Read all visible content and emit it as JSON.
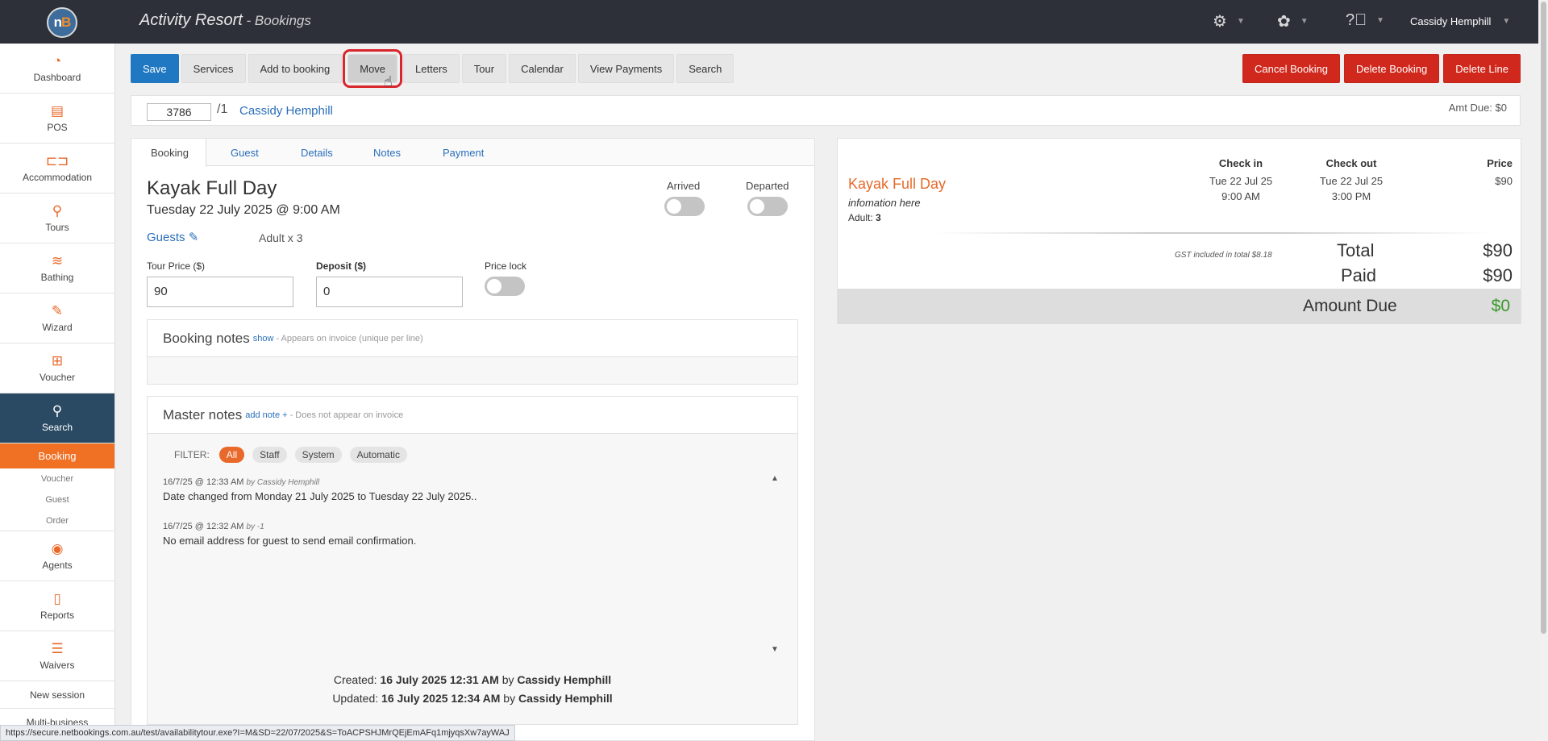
{
  "header": {
    "app_title": "Activity Resort",
    "app_subtitle": " - Bookings",
    "logo_text": "nB",
    "user_name": "Cassidy Hemphill"
  },
  "sidebar": {
    "items": [
      {
        "label": "Dashboard",
        "icon": "⌚"
      },
      {
        "label": "POS",
        "icon": "▤"
      },
      {
        "label": "Accommodation",
        "icon": "🛏"
      },
      {
        "label": "Tours",
        "icon": "⚲"
      },
      {
        "label": "Bathing",
        "icon": "≋"
      },
      {
        "label": "Wizard",
        "icon": "✎"
      },
      {
        "label": "Voucher",
        "icon": "🎁"
      },
      {
        "label": "Search",
        "icon": "🔍"
      }
    ],
    "sub_active": "Booking",
    "sub_items": [
      "Voucher",
      "Guest",
      "Order"
    ],
    "items2": [
      {
        "label": "Agents",
        "icon": "👥"
      },
      {
        "label": "Reports",
        "icon": "📄"
      },
      {
        "label": "Waivers",
        "icon": "☰"
      }
    ],
    "plain_items": [
      "New session",
      "Multi-business"
    ]
  },
  "toolbar": {
    "save": "Save",
    "services": "Services",
    "add_to_booking": "Add to booking",
    "move": "Move",
    "letters": "Letters",
    "tour": "Tour",
    "calendar": "Calendar",
    "view_payments": "View Payments",
    "search": "Search",
    "cancel_booking": "Cancel Booking",
    "delete_booking": "Delete Booking",
    "delete_line": "Delete Line"
  },
  "booking_bar": {
    "number": "3786",
    "suffix": "/1",
    "guest": "Cassidy Hemphill",
    "amt_due": "Amt Due: $0"
  },
  "tabs": [
    "Booking",
    "Guest",
    "Details",
    "Notes",
    "Payment"
  ],
  "booking": {
    "tour_name": "Kayak Full Day",
    "tour_date": "Tuesday 22 July 2025 @ 9:00 AM",
    "guests_label": "Guests",
    "guests_value": "Adult x 3",
    "arrived_label": "Arrived",
    "departed_label": "Departed",
    "tour_price_label": "Tour Price ($)",
    "tour_price": "90",
    "deposit_label": "Deposit ($)",
    "deposit": "0",
    "price_lock_label": "Price lock"
  },
  "booking_notes": {
    "title": "Booking notes",
    "link": "show",
    "hint": "- Appears on invoice (unique per line)"
  },
  "master_notes": {
    "title": "Master notes",
    "link": "add note +",
    "hint": "- Does not appear on invoice",
    "filter_label": "FILTER:",
    "filters": [
      "All",
      "Staff",
      "System",
      "Automatic"
    ],
    "entries": [
      {
        "meta": "16/7/25 @ 12:33 AM",
        "by": "by Cassidy Hemphill",
        "text": "Date changed from Monday 21 July 2025 to Tuesday 22 July 2025.."
      },
      {
        "meta": "16/7/25 @ 12:32 AM",
        "by": "by -1",
        "text": "No email address for guest to send email confirmation."
      }
    ],
    "created_label": "Created:",
    "created_date": "16 July 2025 12:31 AM",
    "created_by_word": "by",
    "created_by": "Cassidy Hemphill",
    "updated_label": "Updated:",
    "updated_date": "16 July 2025 12:34 AM",
    "updated_by_word": "by",
    "updated_by": "Cassidy Hemphill"
  },
  "summary": {
    "check_in_label": "Check in",
    "check_out_label": "Check out",
    "price_label": "Price",
    "item_name": "Kayak Full Day",
    "item_info": "infomation here",
    "adult_label": "Adult:",
    "adult_count": "3",
    "check_in_date": "Tue 22 Jul 25",
    "check_in_time": "9:00 AM",
    "check_out_date": "Tue 22 Jul 25",
    "check_out_time": "3:00 PM",
    "price": "$90",
    "gst": "GST included in total $8.18",
    "total_label": "Total",
    "total": "$90",
    "paid_label": "Paid",
    "paid": "$90",
    "due_label": "Amount Due",
    "due": "$0"
  },
  "status_url": "https://secure.netbookings.com.au/test/availabilitytour.exe?I=M&SD=22/07/2025&S=ToACPSHJMrQEjEmAFq1mjyqsXw7ayWAJ"
}
